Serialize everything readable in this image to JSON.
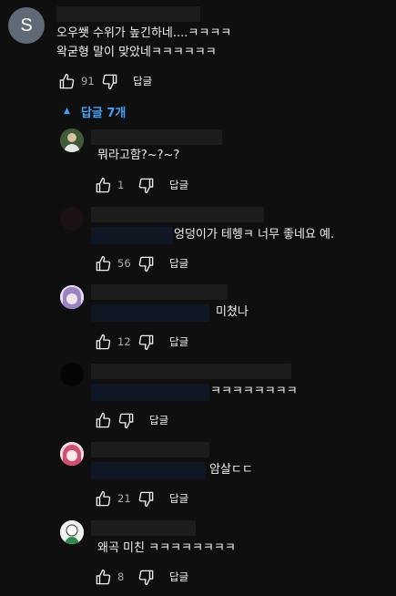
{
  "main_comment": {
    "avatar_letter": "S",
    "lines": [
      "오우쐣 수위가 높긴하네....ㅋㅋㅋㅋ",
      "왁굳형 말이 맞았네ㅋㅋㅋㅋㅋㅋ"
    ],
    "likes": "91",
    "reply_label": "답글"
  },
  "replies_toggle": {
    "label": "답글 7개"
  },
  "replies": [
    {
      "text": "뭐라고함?~?~?",
      "likes": "1",
      "reply_label": "답글"
    },
    {
      "text": "엉덩이가 테헹ㅋ 너무 좋네요 예.",
      "likes": "56",
      "reply_label": "답글"
    },
    {
      "text": "미쳤나",
      "likes": "12",
      "reply_label": "답글"
    },
    {
      "text": "ㅋㅋㅋㅋㅋㅋㅋㅋ",
      "likes": "",
      "reply_label": "답글"
    },
    {
      "text": "암살ㄷㄷ",
      "likes": "21",
      "reply_label": "답글"
    },
    {
      "text": "왜곡 미친 ㅋㅋㅋㅋㅋㅋㅋㅋ",
      "likes": "8",
      "reply_label": "답글"
    }
  ],
  "icons": {
    "like": "thumbs-up-icon",
    "dislike": "thumbs-down-icon",
    "caret": "caret-up-icon"
  },
  "colors": {
    "background": "#0f0f0f",
    "link": "#3ea6ff",
    "secondary_text": "#aaaaaa"
  }
}
